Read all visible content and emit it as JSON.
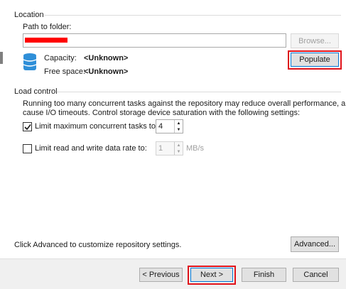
{
  "location": {
    "section_title": "Location",
    "path_label": "Path to folder:",
    "path_value": "",
    "browse_label": "Browse...",
    "capacity_label": "Capacity:",
    "capacity_value": "<Unknown>",
    "free_space_label": "Free space:",
    "free_space_value": "<Unknown>",
    "populate_label": "Populate",
    "storage_icon": "database-icon"
  },
  "load_control": {
    "section_title": "Load control",
    "description_line1": "Running too many concurrent tasks against the repository may reduce overall performance, and",
    "description_line2": "cause I/O timeouts. Control storage device saturation with the following settings:",
    "limit_tasks_label": "Limit maximum concurrent tasks to:",
    "limit_tasks_checked": true,
    "limit_tasks_value": "4",
    "limit_rate_label": "Limit read and write data rate to:",
    "limit_rate_checked": false,
    "limit_rate_value": "1",
    "limit_rate_unit": "MB/s"
  },
  "advanced": {
    "hint": "Click Advanced to customize repository settings.",
    "button_label": "Advanced..."
  },
  "footer": {
    "previous_label": "< Previous",
    "next_label": "Next >",
    "finish_label": "Finish",
    "cancel_label": "Cancel"
  },
  "colors": {
    "highlight": "#e0121a",
    "db_icon": "#2f8fd8"
  }
}
